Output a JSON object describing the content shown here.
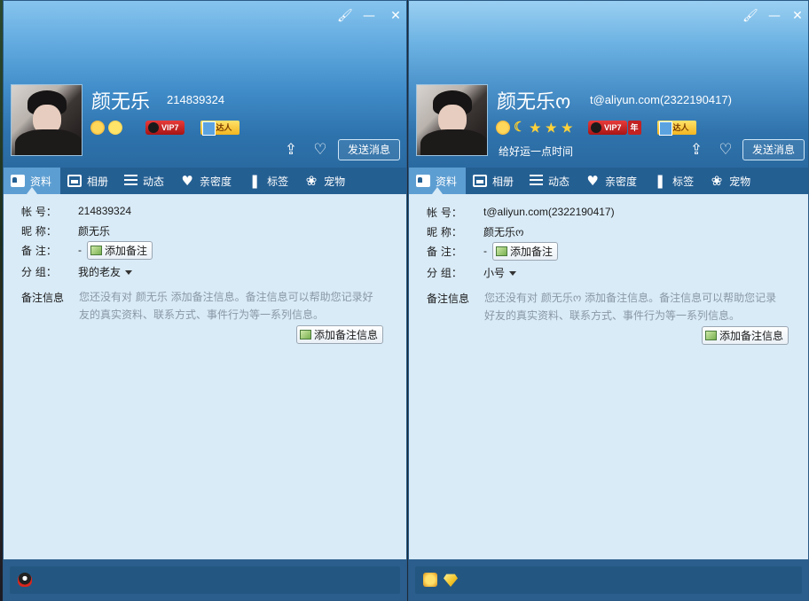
{
  "window_left": {
    "controls": {
      "skin": "🖌",
      "minimize": "—",
      "close": "✕"
    },
    "profile": {
      "name": "颜无乐",
      "account_header": "214839324",
      "badges": [
        "crown-icon",
        "smile-icon",
        "vip-badge",
        "daren-badge"
      ],
      "vip_label": "VIP7",
      "daren_label": "达人",
      "send_label": "发送消息"
    },
    "tabs": [
      {
        "label": "资料",
        "icon": "profile-card-icon"
      },
      {
        "label": "相册",
        "icon": "album-icon"
      },
      {
        "label": "动态",
        "icon": "feed-icon"
      },
      {
        "label": "亲密度",
        "icon": "heart-icon"
      },
      {
        "label": "标签",
        "icon": "tag-icon"
      },
      {
        "label": "宠物",
        "icon": "pet-icon"
      }
    ],
    "fields": {
      "account_label": "帐 号：",
      "account": "214839324",
      "nickname_label": "昵 称：",
      "nickname": "颜无乐",
      "remark_label": "备 注：",
      "remark": "-",
      "add_remark": "添加备注",
      "group_label": "分 组：",
      "group": "我的老友"
    },
    "note": {
      "label": "备注信息",
      "text": "您还没有对 颜无乐 添加备注信息。备注信息可以帮助您记录好友的真实资料、联系方式、事件行为等一系列信息。",
      "button": "添加备注信息"
    }
  },
  "window_right": {
    "controls": {
      "skin": "🖌",
      "minimize": "—",
      "close": "✕"
    },
    "profile": {
      "name": "颜无乐ო",
      "account_header": "t@aliyun.com(2322190417)",
      "signature": "给好运一点时间",
      "vip_label": "VIP7",
      "year_label": "年",
      "daren_label": "达人",
      "send_label": "发送消息"
    },
    "tabs": [
      {
        "label": "资料",
        "icon": "profile-card-icon"
      },
      {
        "label": "相册",
        "icon": "album-icon"
      },
      {
        "label": "动态",
        "icon": "feed-icon"
      },
      {
        "label": "亲密度",
        "icon": "heart-icon"
      },
      {
        "label": "标签",
        "icon": "tag-icon"
      },
      {
        "label": "宠物",
        "icon": "pet-icon"
      }
    ],
    "fields": {
      "account_label": "帐 号：",
      "account": "t@aliyun.com(2322190417)",
      "nickname_label": "昵 称：",
      "nickname": "颜无乐ო",
      "remark_label": "备 注：",
      "remark": "-",
      "add_remark": "添加备注",
      "group_label": "分 组：",
      "group": "小号"
    },
    "note": {
      "label": "备注信息",
      "text": "您还没有对 颜无乐ო 添加备注信息。备注信息可以帮助您记录好友的真实资料、联系方式、事件行为等一系列信息。",
      "button": "添加备注信息"
    }
  }
}
